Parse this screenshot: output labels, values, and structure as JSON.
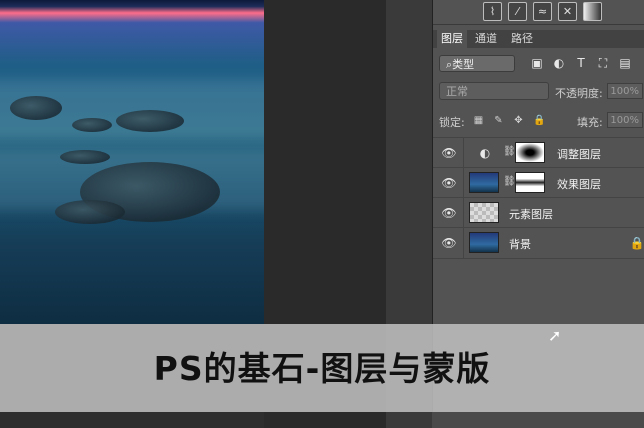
{
  "layers_panel": {
    "tabs": [
      "图层",
      "通道",
      "路径"
    ],
    "filter_kind": "⌕类型",
    "blend_mode": "正常",
    "opacity_label": "不透明度:",
    "opacity_value": "100%",
    "lock_label": "锁定:",
    "fill_label": "填充:",
    "fill_value": "100%",
    "layers": [
      {
        "name": "调整图层"
      },
      {
        "name": "效果图层"
      },
      {
        "name": "元素图层"
      },
      {
        "name": "背景"
      }
    ]
  },
  "caption": "PS的基石-图层与蒙版",
  "icons": {
    "top": [
      "brush-icon",
      "brush2-icon",
      "wave-icon",
      "x-icon",
      "gradient-icon"
    ],
    "filter": [
      "image-icon",
      "circle-half-icon",
      "text-icon",
      "transform-icon",
      "smart-icon"
    ],
    "lock": [
      "checker-icon",
      "brush-lock-icon",
      "move-icon",
      "lock-icon"
    ]
  }
}
